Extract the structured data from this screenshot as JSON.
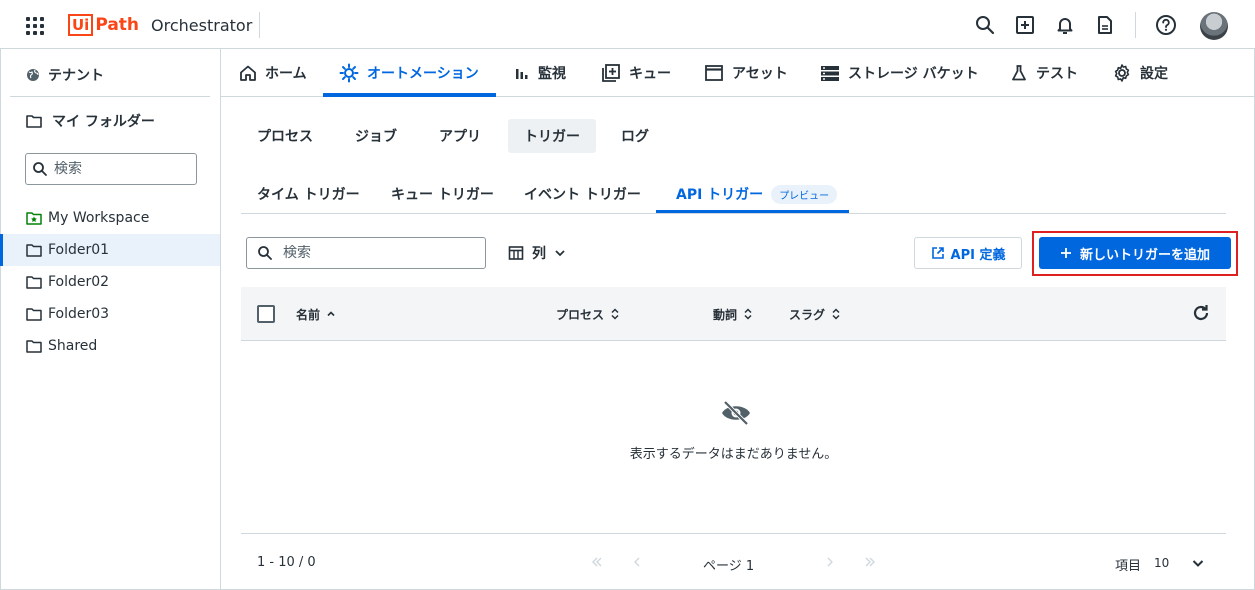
{
  "header": {
    "logo_mark": "Ui",
    "logo_path": "Path",
    "product": "Orchestrator"
  },
  "sidebar": {
    "tenant": "テナント",
    "my_folder": "マイ フォルダー",
    "search_placeholder": "検索",
    "folders": [
      {
        "label": "My Workspace",
        "icon": "workspace-icon"
      },
      {
        "label": "Folder01",
        "icon": "folder-icon",
        "active": true
      },
      {
        "label": "Folder02",
        "icon": "folder-icon"
      },
      {
        "label": "Folder03",
        "icon": "folder-icon"
      },
      {
        "label": "Shared",
        "icon": "folder-icon"
      }
    ]
  },
  "nav": {
    "items": [
      {
        "label": "ホーム",
        "icon": "home-icon"
      },
      {
        "label": "オートメーション",
        "icon": "automation-icon",
        "active": true
      },
      {
        "label": "監視",
        "icon": "monitoring-icon"
      },
      {
        "label": "キュー",
        "icon": "queue-icon"
      },
      {
        "label": "アセット",
        "icon": "asset-icon"
      },
      {
        "label": "ストレージ バケット",
        "icon": "storage-icon"
      },
      {
        "label": "テスト",
        "icon": "flask-icon"
      },
      {
        "label": "設定",
        "icon": "gear-icon"
      }
    ]
  },
  "subtabs": [
    "プロセス",
    "ジョブ",
    "アプリ",
    "トリガー",
    "ログ"
  ],
  "trigger_tabs": {
    "time": "タイム トリガー",
    "queue": "キュー トリガー",
    "event": "イベント トリガー",
    "api": "API トリガー",
    "preview_badge": "プレビュー"
  },
  "toolbar": {
    "search_placeholder": "検索",
    "columns_label": "列",
    "api_definition": "API 定義",
    "add_trigger": "新しいトリガーを追加"
  },
  "table": {
    "columns": [
      "名前",
      "プロセス",
      "動詞",
      "スラグ"
    ],
    "empty_message": "表示するデータはまだありません。"
  },
  "pager": {
    "range": "1 - 10 / 0",
    "page": "ページ 1",
    "items_label": "項目",
    "items_value": "10"
  },
  "colors": {
    "accent": "#0067df",
    "brand": "#fa4616",
    "highlight_border": "#e02020"
  }
}
